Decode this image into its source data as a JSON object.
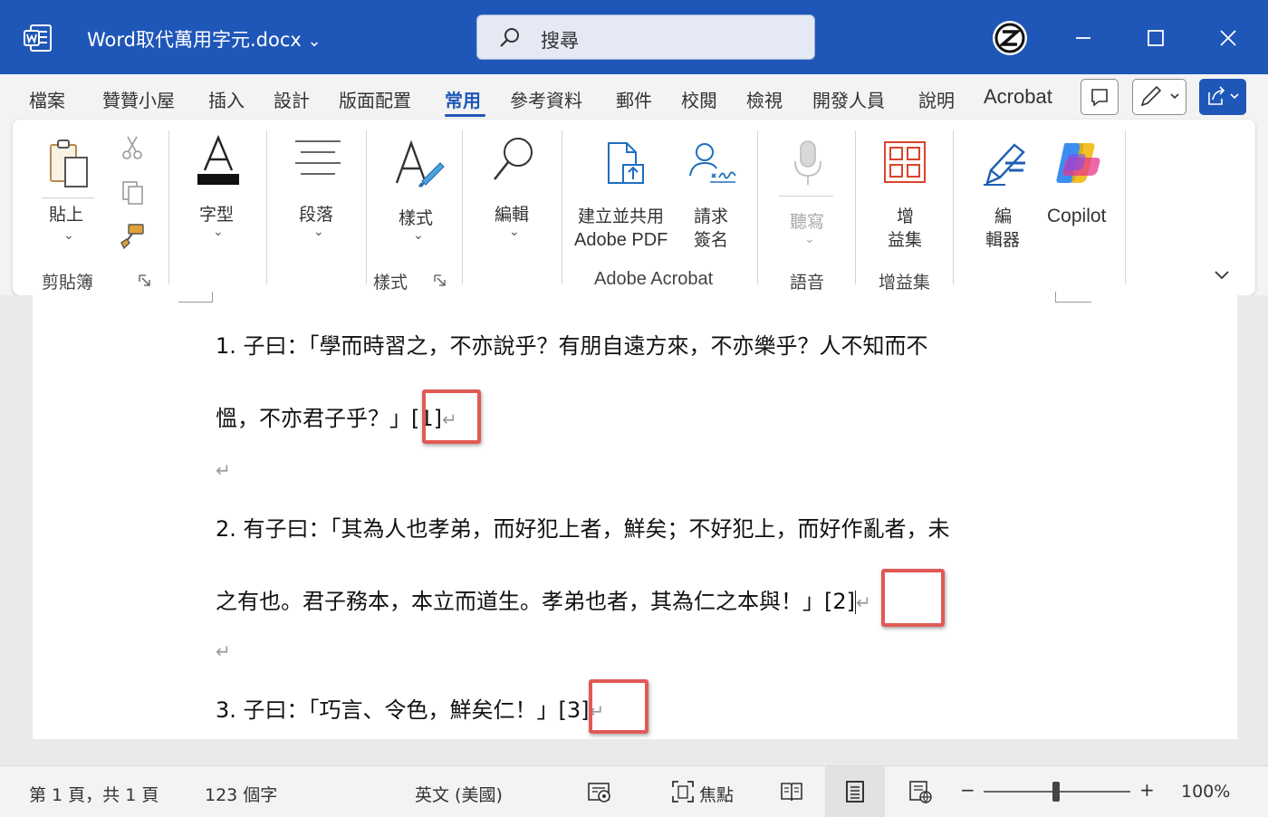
{
  "window": {
    "title": "Word取代萬用字元.docx",
    "title_chevron": "⌄",
    "search_placeholder": "搜尋",
    "accent": "#1f57b8"
  },
  "menu": {
    "tabs": [
      "檔案",
      "贊贊小屋",
      "插入",
      "設計",
      "版面配置",
      "常用",
      "參考資料",
      "郵件",
      "校閱",
      "檢視",
      "開發人員",
      "說明",
      "Acrobat"
    ],
    "active_tab": "常用"
  },
  "ribbon": {
    "clipboard": {
      "paste_label": "貼上",
      "group_label": "剪貼簿"
    },
    "font": {
      "label": "字型"
    },
    "paragraph": {
      "label": "段落"
    },
    "styles": {
      "label": "樣式",
      "group_label": "樣式"
    },
    "editing": {
      "label": "編輯"
    },
    "acrobat": {
      "create_line1": "建立並共用",
      "create_line2": "Adobe PDF",
      "sign_line1": "請求",
      "sign_line2": "簽名",
      "group_label": "Adobe Acrobat"
    },
    "voice": {
      "dictate_label": "聽寫",
      "group_label": "語音"
    },
    "addins": {
      "line1": "增",
      "line2": "益集",
      "group_label": "增益集"
    },
    "editor": {
      "line1": "編",
      "line2": "輯器"
    },
    "copilot": {
      "label": "Copilot"
    }
  },
  "document": {
    "para1_line1": "1. 子曰：「學而時習之，不亦說乎？有朋自遠方來，不亦樂乎？人不知而不",
    "para1_line2": "慍，不亦君子乎？」",
    "note1": "[1]",
    "para2_line1": "2. 有子曰：「其為人也孝弟，而好犯上者，鮮矣；不好犯上，而好作亂者，未",
    "para2_line2": "之有也。君子務本，本立而道生。孝弟也者，其為仁之本與！」",
    "note2": "[2]",
    "para3_line1": "3. 子曰：「巧言、令色，鮮矣仁！」",
    "note3": "[3]",
    "paragraph_mark": "↵",
    "highlight_color": "#e05a55"
  },
  "status": {
    "page": "第 1 頁，共 1 頁",
    "words": "123 個字",
    "language": "英文 (美國)",
    "focus": "焦點",
    "zoom_minus": "−",
    "zoom_plus": "+",
    "zoom": "100%",
    "zoom_value": 100
  }
}
